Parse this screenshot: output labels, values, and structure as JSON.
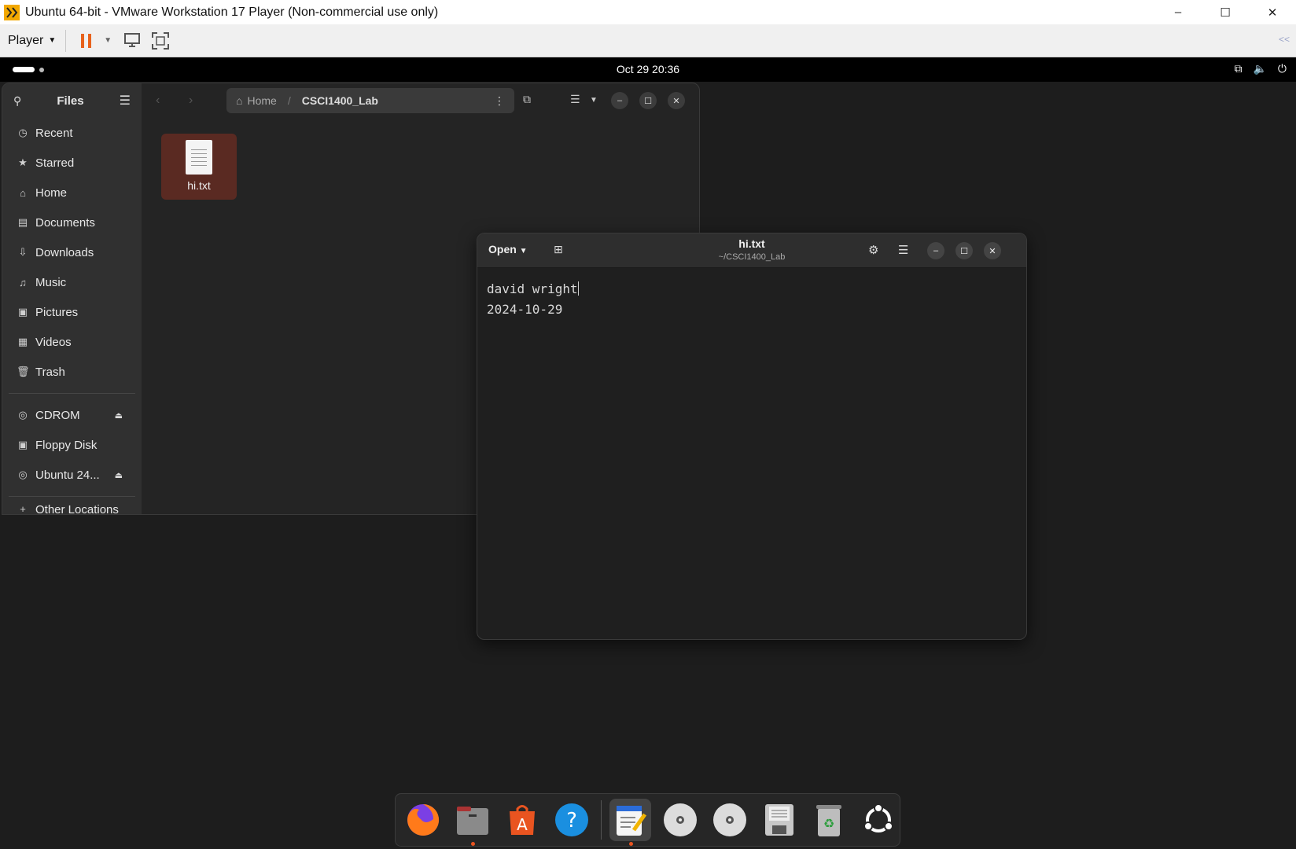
{
  "vm": {
    "title": "Ubuntu 64-bit - VMware Workstation 17 Player (Non-commercial use only)",
    "player_label": "Player",
    "collapse_label": "<<"
  },
  "topbar": {
    "clock": "Oct 29  20:36"
  },
  "files": {
    "title": "Files",
    "path": {
      "home": "Home",
      "current": "CSCI1400_Lab"
    },
    "sidebar": {
      "items": [
        {
          "label": "Recent",
          "icon": "clock-icon"
        },
        {
          "label": "Starred",
          "icon": "star-icon"
        },
        {
          "label": "Home",
          "icon": "home-icon"
        },
        {
          "label": "Documents",
          "icon": "document-icon"
        },
        {
          "label": "Downloads",
          "icon": "download-icon"
        },
        {
          "label": "Music",
          "icon": "music-icon"
        },
        {
          "label": "Pictures",
          "icon": "picture-icon"
        },
        {
          "label": "Videos",
          "icon": "video-icon"
        },
        {
          "label": "Trash",
          "icon": "trash-icon"
        }
      ],
      "devices": [
        {
          "label": "CDROM",
          "icon": "disc-icon",
          "eject": true
        },
        {
          "label": "Floppy Disk",
          "icon": "floppy-icon",
          "eject": false
        },
        {
          "label": "Ubuntu 24...",
          "icon": "disc-icon",
          "eject": true
        }
      ],
      "other": "Other Locations"
    },
    "file": {
      "name": "hi.txt"
    }
  },
  "editor": {
    "open_label": "Open",
    "title": "hi.txt",
    "subtitle": "~/CSCI1400_Lab",
    "lines": [
      "david wright",
      "2024-10-29"
    ]
  },
  "dock": {
    "apps": [
      "firefox",
      "files",
      "app-center",
      "help",
      "text-editor",
      "cdrom",
      "cdrom-2",
      "floppy",
      "trash",
      "ubuntu"
    ]
  },
  "colors": {
    "accent": "#e95420",
    "selection": "#5a2a22"
  }
}
